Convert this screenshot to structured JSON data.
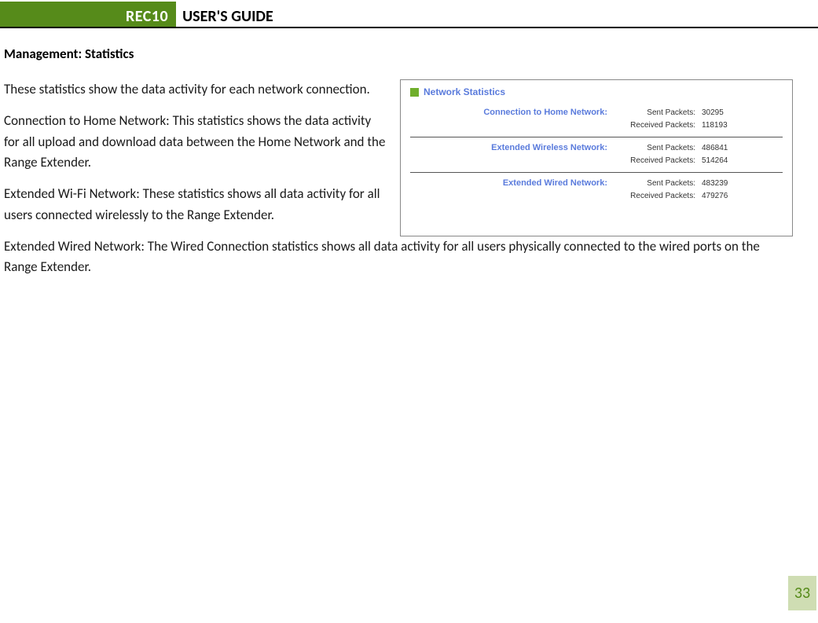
{
  "header": {
    "product": "REC10",
    "title": "USER'S GUIDE"
  },
  "section_title": "Management: Statistics",
  "paragraphs": {
    "p1": "These statistics show the data activity for each network connection.",
    "p2": "Connection to Home Network: This statistics shows the data activity for all upload and download data between the Home Network and the Range Extender.",
    "p3": "Extended Wi-Fi Network: These statistics shows all data activity for all users connected wirelessly to the Range Extender.",
    "p4": "Extended Wired Network: The Wired Connection statistics shows all data activity for all users physically connected to the wired ports on the Range Extender."
  },
  "panel": {
    "title": "Network Statistics",
    "labels": {
      "sent": "Sent Packets:",
      "received": "Received Packets:"
    },
    "groups": [
      {
        "name": "Connection to Home Network:",
        "sent": "30295",
        "received": "118193"
      },
      {
        "name": "Extended Wireless Network:",
        "sent": "486841",
        "received": "514264"
      },
      {
        "name": "Extended Wired Network:",
        "sent": "483239",
        "received": "479276"
      }
    ]
  },
  "page_number": "33"
}
